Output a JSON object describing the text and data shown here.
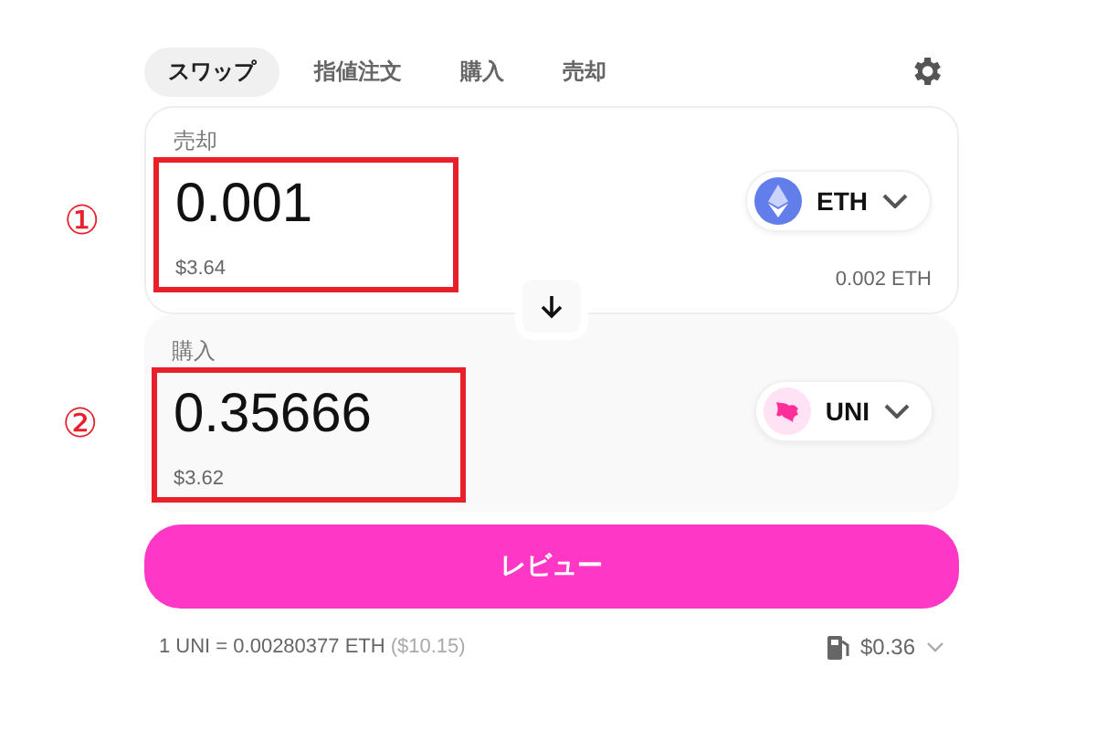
{
  "tabs": [
    {
      "label": "スワップ",
      "selected": true
    },
    {
      "label": "指値注文",
      "selected": false
    },
    {
      "label": "購入",
      "selected": false
    },
    {
      "label": "売却",
      "selected": false
    }
  ],
  "panels": [
    {
      "label": "売却",
      "amount": "0.001",
      "usd": "$3.64",
      "token": "ETH",
      "kind": "eth",
      "balance": "0.002 ETH",
      "marker": "①",
      "highlighted": true
    },
    {
      "label": "購入",
      "amount": "0.35666",
      "usd": "$3.62",
      "token": "UNI",
      "kind": "uni",
      "marker": "②",
      "highlighted": true
    }
  ],
  "review_button": "レビュー",
  "footer": {
    "rate": "1 UNI = 0.00280377 ETH",
    "rate_usd": "($10.15)",
    "gas": "$0.36"
  }
}
